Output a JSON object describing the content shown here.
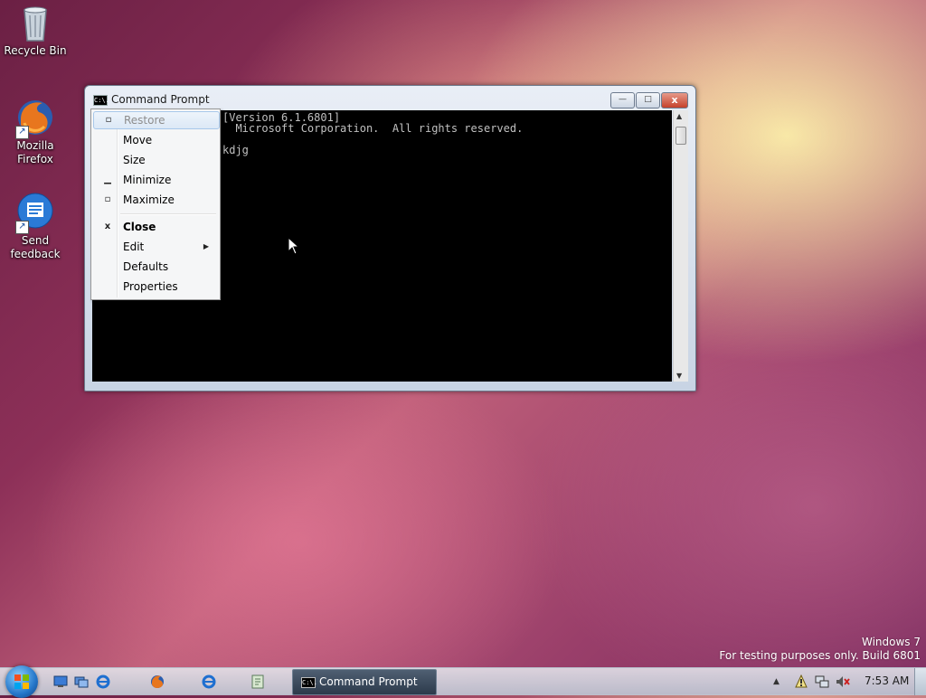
{
  "desktop": {
    "icons": [
      {
        "label_line1": "Recycle Bin",
        "label_line2": ""
      },
      {
        "label_line1": "Mozilla",
        "label_line2": "Firefox"
      },
      {
        "label_line1": "Send",
        "label_line2": "feedback"
      }
    ]
  },
  "window": {
    "title": "Command Prompt",
    "icon_text": "C:\\.",
    "buttons": {
      "minimize": "—",
      "maximize": "□",
      "close": "x"
    },
    "console_lines": [
      "[Version 6.1.6801]",
      "  Microsoft Corporation.  All rights reserved.",
      "",
      "kdjg"
    ]
  },
  "system_menu": {
    "items": [
      {
        "label": "Restore",
        "glyph": "▫",
        "state": "disabled"
      },
      {
        "label": "Move",
        "glyph": "",
        "state": "normal"
      },
      {
        "label": "Size",
        "glyph": "",
        "state": "normal"
      },
      {
        "label": "Minimize",
        "glyph": "▁",
        "state": "normal"
      },
      {
        "label": "Maximize",
        "glyph": "▫",
        "state": "normal"
      },
      {
        "label": "Close",
        "glyph": "x",
        "state": "bold"
      },
      {
        "label": "Edit",
        "glyph": "",
        "state": "submenu"
      },
      {
        "label": "Defaults",
        "glyph": "",
        "state": "normal"
      },
      {
        "label": "Properties",
        "glyph": "",
        "state": "normal"
      }
    ]
  },
  "watermark": {
    "line1": "Windows 7",
    "line2": "For testing purposes only. Build 6801"
  },
  "taskbar": {
    "active_task": "Command Prompt",
    "task_icon_text": "C:\\.",
    "clock": "7:53 AM"
  }
}
